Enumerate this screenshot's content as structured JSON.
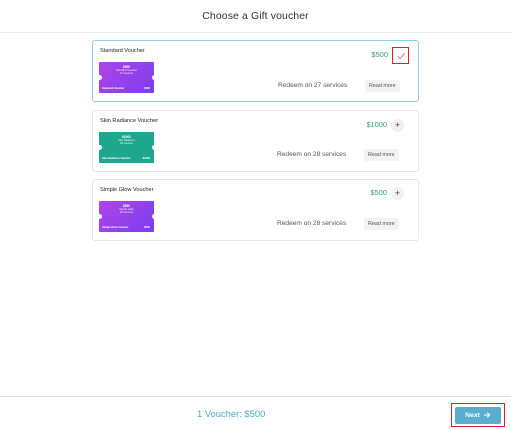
{
  "header": {
    "title": "Choose a Gift voucher"
  },
  "vouchers": [
    {
      "name": "Standard Voucher",
      "price": "$500",
      "redeem": "Redeem on 27 services",
      "read_more": "Read more",
      "selected": true,
      "ticket": {
        "amount": "$500",
        "line1": "Standard Voucher",
        "line2": "27 services",
        "name": "Standard Voucher",
        "value": "$500"
      }
    },
    {
      "name": "Skin Radiance Voucher",
      "price": "$1000",
      "redeem": "Redeem on 28 services",
      "read_more": "Read more",
      "selected": false,
      "ticket": {
        "amount": "$1000",
        "line1": "Skin Radiance",
        "line2": "28 services",
        "name": "Skin Radiance Voucher",
        "value": "$1000"
      }
    },
    {
      "name": "Simple Glow Voucher",
      "price": "$500",
      "redeem": "Redeem on 28 services",
      "read_more": "Read more",
      "selected": false,
      "ticket": {
        "amount": "$500",
        "line1": "Simple Glow",
        "line2": "28 services",
        "name": "Simple Glow Voucher",
        "value": "$500"
      }
    }
  ],
  "footer": {
    "summary": "1 Voucher: $500",
    "next_label": "Next"
  },
  "colors": {
    "accent": "#59aed0",
    "price": "#3a9b73",
    "highlight": "#d3262c"
  }
}
